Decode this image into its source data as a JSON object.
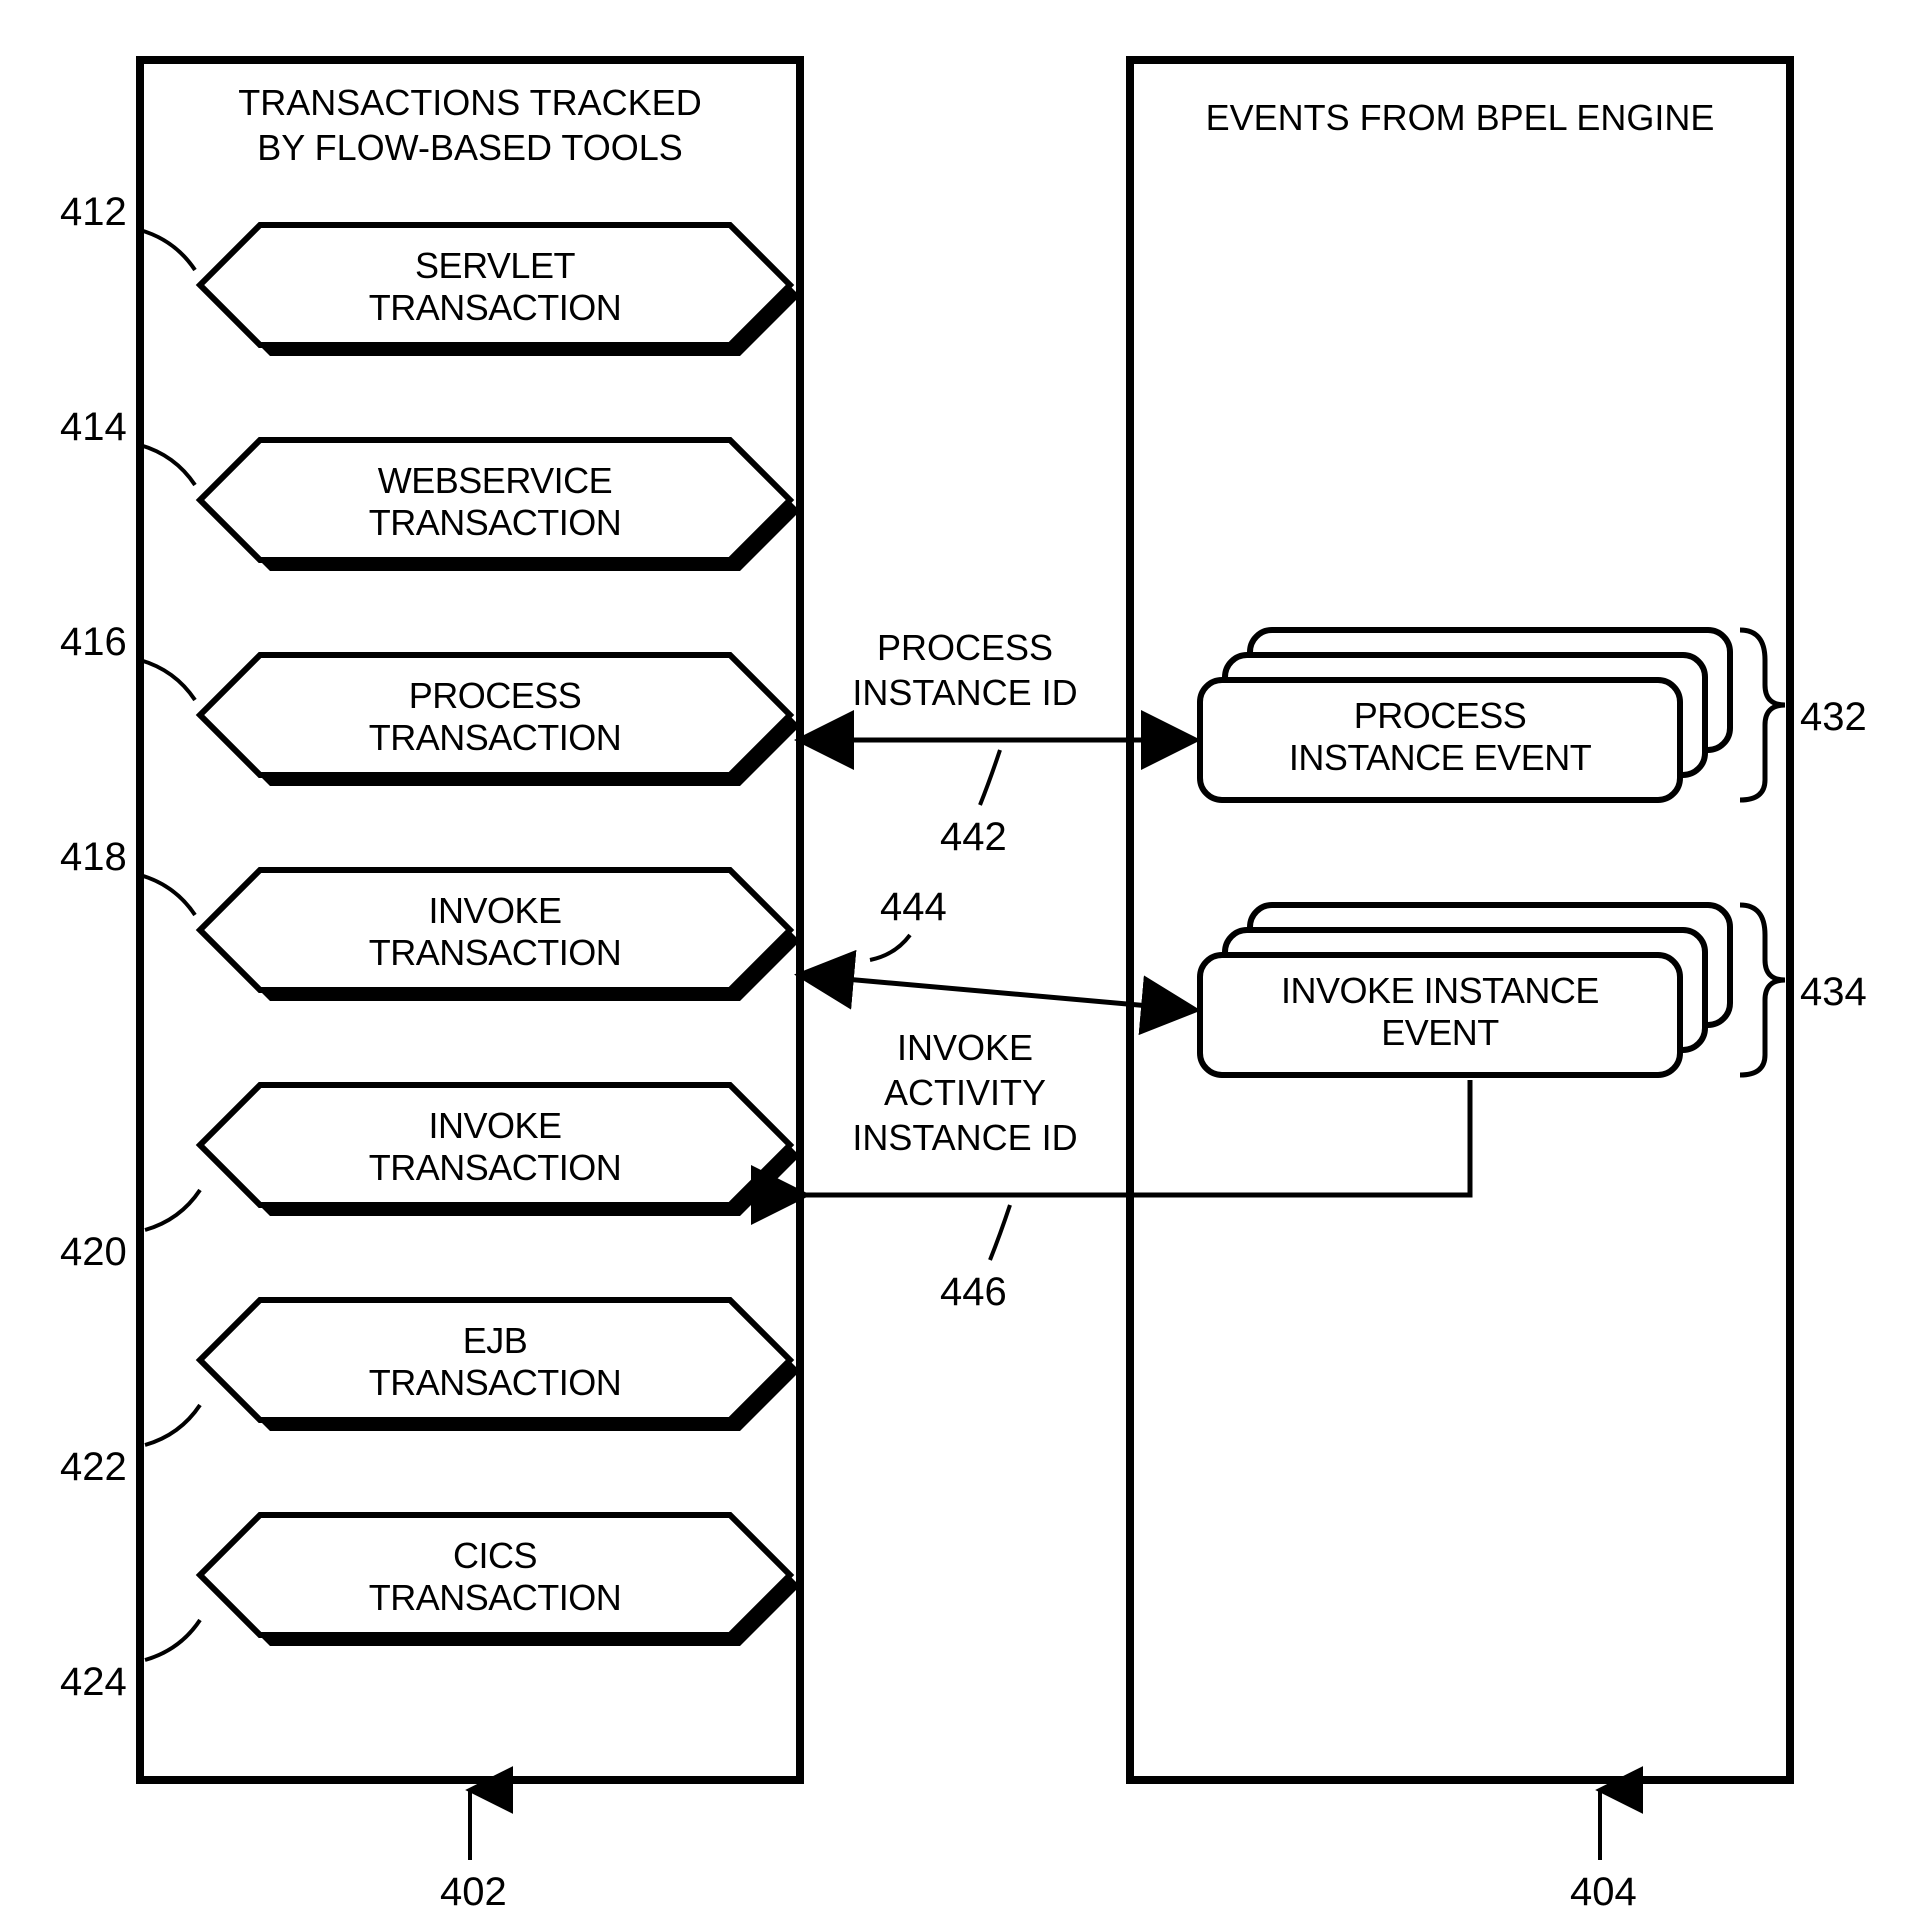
{
  "left_box": {
    "title_l1": "TRANSACTIONS TRACKED",
    "title_l2": "BY FLOW-BASED TOOLS",
    "ref": "402"
  },
  "right_box": {
    "title": "EVENTS FROM BPEL ENGINE",
    "ref": "404"
  },
  "hex": {
    "servlet": {
      "l1": "SERVLET",
      "l2": "TRANSACTION",
      "ref": "412"
    },
    "web": {
      "l1": "WEBSERVICE",
      "l2": "TRANSACTION",
      "ref": "414"
    },
    "process": {
      "l1": "PROCESS",
      "l2": "TRANSACTION",
      "ref": "416"
    },
    "invoke1": {
      "l1": "INVOKE",
      "l2": "TRANSACTION",
      "ref": "418"
    },
    "invoke2": {
      "l1": "INVOKE",
      "l2": "TRANSACTION",
      "ref": "420"
    },
    "ejb": {
      "l1": "EJB",
      "l2": "TRANSACTION",
      "ref": "422"
    },
    "cics": {
      "l1": "CICS",
      "l2": "TRANSACTION",
      "ref": "424"
    }
  },
  "events": {
    "process": {
      "l1": "PROCESS",
      "l2": "INSTANCE EVENT",
      "ref": "432"
    },
    "invoke": {
      "l1": "INVOKE INSTANCE",
      "l2": "EVENT",
      "ref": "434"
    }
  },
  "links": {
    "pid": {
      "l1": "PROCESS",
      "l2": "INSTANCE ID",
      "ref": "442"
    },
    "iaid": {
      "l1": "INVOKE",
      "l2": "ACTIVITY",
      "l3": "INSTANCE ID",
      "ref_top": "444",
      "ref_bot": "446"
    }
  }
}
